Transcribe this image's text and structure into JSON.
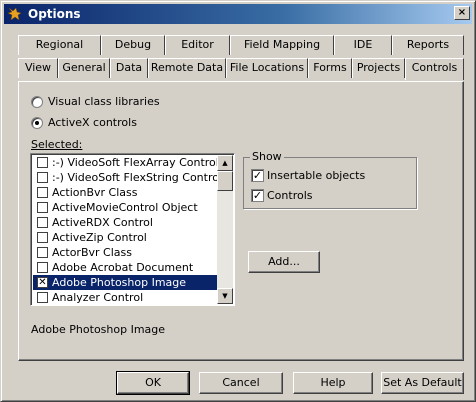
{
  "window": {
    "title": "Options",
    "close_glyph": "×"
  },
  "tabs_row1": [
    "Regional",
    "Debug",
    "Editor",
    "Field Mapping",
    "IDE",
    "Reports"
  ],
  "tabs_row2": [
    "View",
    "General",
    "Data",
    "Remote Data",
    "File Locations",
    "Forms",
    "Projects",
    "Controls"
  ],
  "active_tab": "Controls",
  "radios": [
    {
      "label": "Visual class libraries",
      "checked": false
    },
    {
      "label": "ActiveX controls",
      "checked": true
    }
  ],
  "selected_label": "Selected:",
  "list_items": [
    {
      "label": ":-) VideoSoft FlexArray Control",
      "checked": false,
      "selected": false
    },
    {
      "label": ":-) VideoSoft FlexString Control",
      "checked": false,
      "selected": false
    },
    {
      "label": "ActionBvr Class",
      "checked": false,
      "selected": false
    },
    {
      "label": "ActiveMovieControl Object",
      "checked": false,
      "selected": false
    },
    {
      "label": "ActiveRDX Control",
      "checked": false,
      "selected": false
    },
    {
      "label": "ActiveZip Control",
      "checked": false,
      "selected": false
    },
    {
      "label": "ActorBvr Class",
      "checked": false,
      "selected": false
    },
    {
      "label": "Adobe Acrobat Document",
      "checked": false,
      "selected": false
    },
    {
      "label": "Adobe Photoshop Image",
      "checked": true,
      "selected": true
    },
    {
      "label": "Analyzer Control",
      "checked": false,
      "selected": false
    }
  ],
  "show_group": {
    "legend": "Show",
    "options": [
      {
        "label": "Insertable objects",
        "checked": true
      },
      {
        "label": "Controls",
        "checked": true
      }
    ]
  },
  "add_button": "Add...",
  "status_text": "Adobe Photoshop Image",
  "footer_buttons": [
    "OK",
    "Cancel",
    "Help",
    "Set As Default"
  ]
}
